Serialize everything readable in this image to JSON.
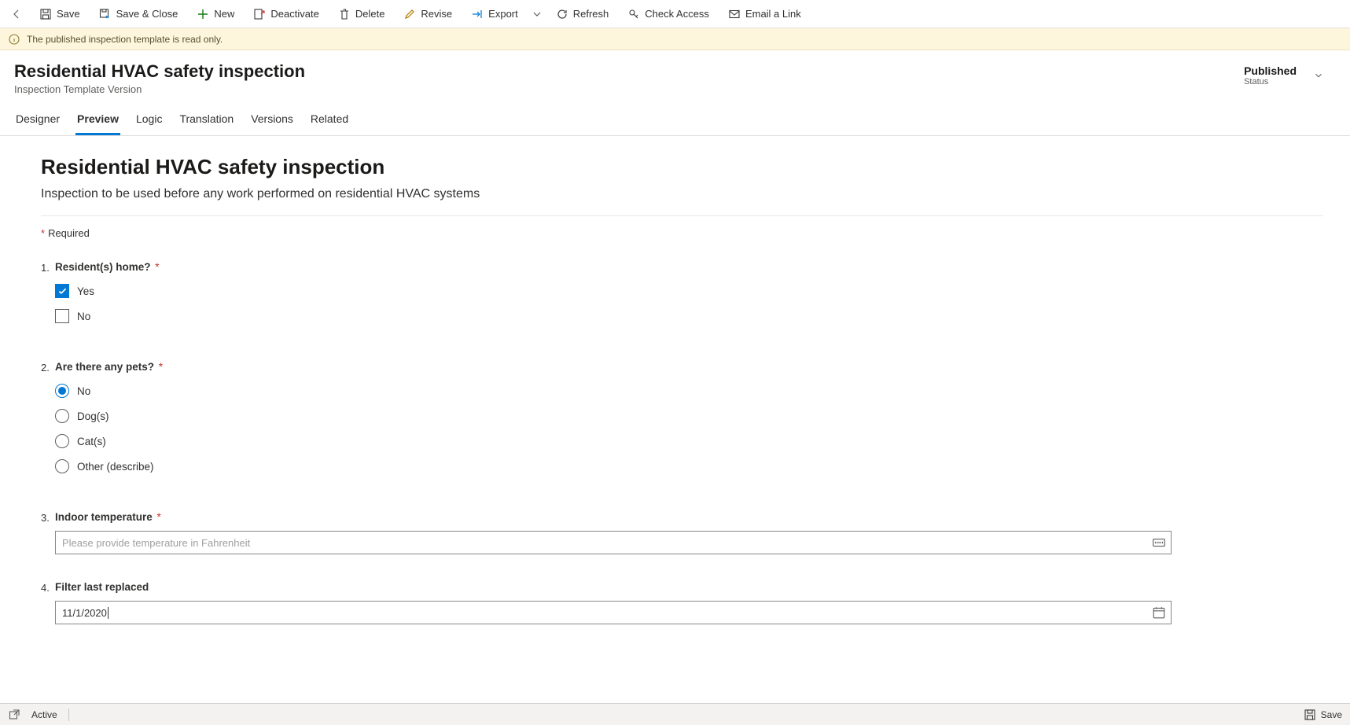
{
  "toolbar": {
    "save": "Save",
    "save_close": "Save & Close",
    "new": "New",
    "deactivate": "Deactivate",
    "delete": "Delete",
    "revise": "Revise",
    "export": "Export",
    "refresh": "Refresh",
    "check_access": "Check Access",
    "email_link": "Email a Link"
  },
  "notification": "The published inspection template is read only.",
  "header": {
    "title": "Residential HVAC safety inspection",
    "subtitle": "Inspection Template Version",
    "status_value": "Published",
    "status_label": "Status"
  },
  "tabs": {
    "designer": "Designer",
    "preview": "Preview",
    "logic": "Logic",
    "translation": "Translation",
    "versions": "Versions",
    "related": "Related"
  },
  "form": {
    "title": "Residential HVAC safety inspection",
    "description": "Inspection to be used before any work performed on residential HVAC systems",
    "required_label": "Required",
    "q1": {
      "num": "1.",
      "label": "Resident(s) home?",
      "opt_yes": "Yes",
      "opt_no": "No"
    },
    "q2": {
      "num": "2.",
      "label": "Are there any pets?",
      "opt_no": "No",
      "opt_dogs": "Dog(s)",
      "opt_cats": "Cat(s)",
      "opt_other": "Other (describe)"
    },
    "q3": {
      "num": "3.",
      "label": "Indoor temperature",
      "placeholder": "Please provide temperature in Fahrenheit",
      "value": ""
    },
    "q4": {
      "num": "4.",
      "label": "Filter last replaced",
      "value": "11/1/2020"
    }
  },
  "footer": {
    "status": "Active",
    "save": "Save"
  }
}
